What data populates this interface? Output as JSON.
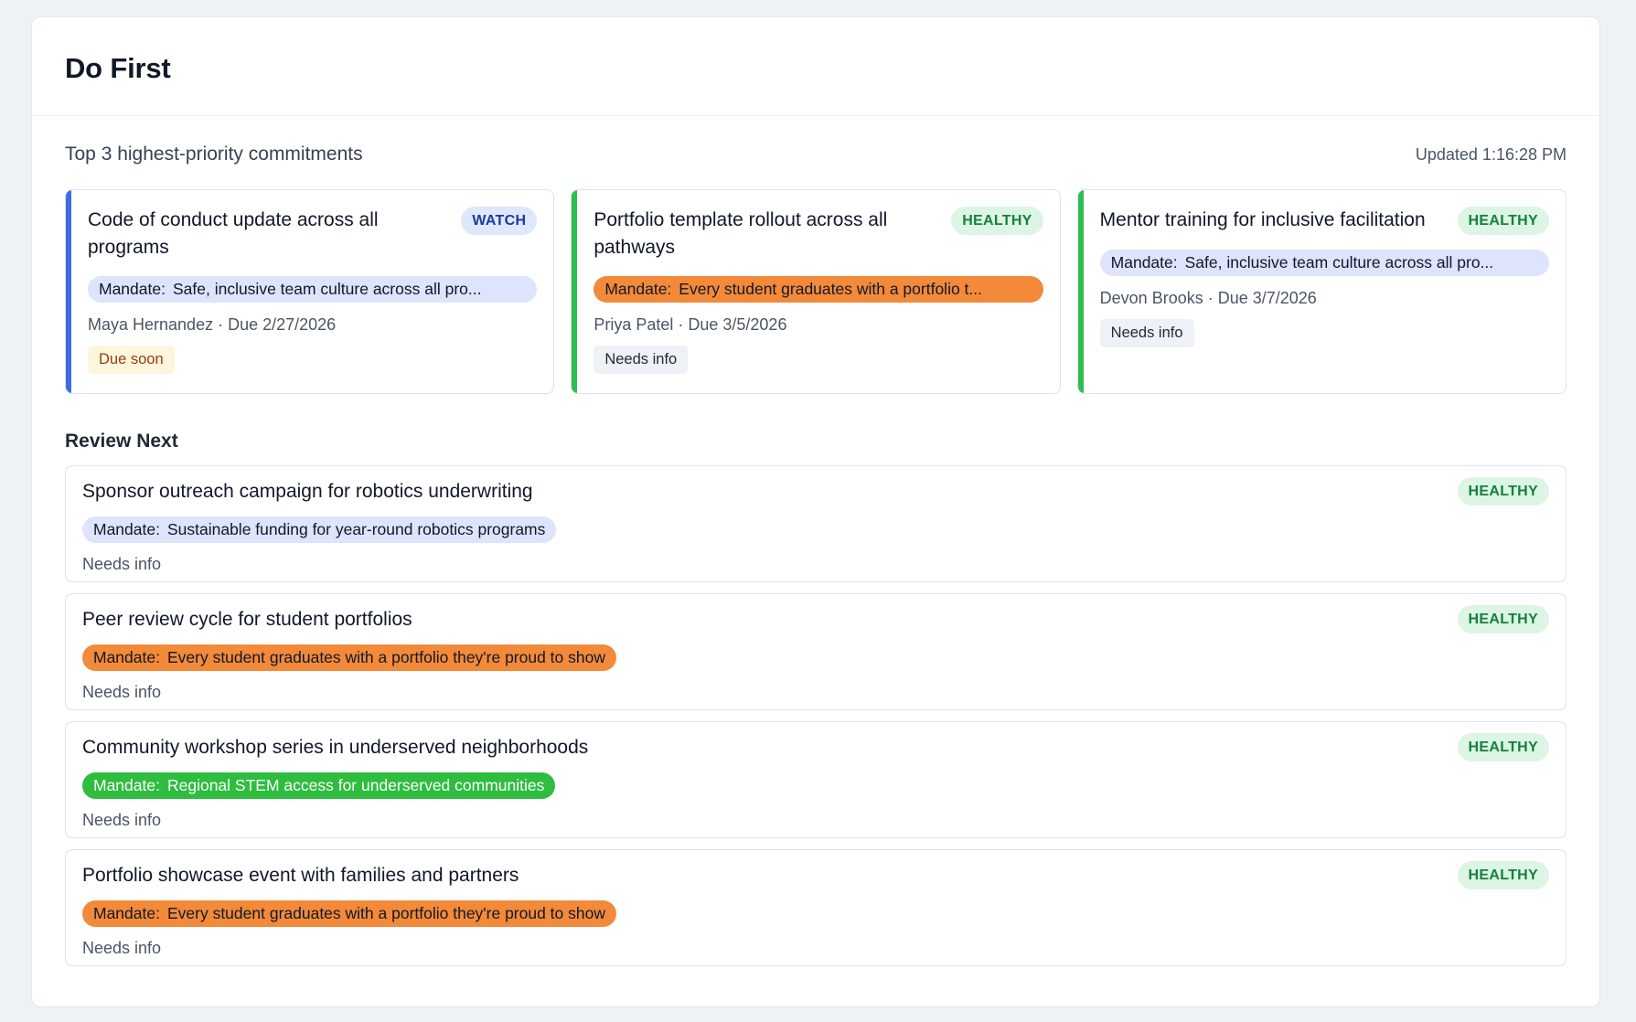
{
  "header": {
    "title": "Do First"
  },
  "subheading": "Top 3 highest-priority commitments",
  "updated": "Updated 1:16:28 PM",
  "mandate_label": "Mandate:",
  "colors": {
    "watch_accent": "#3b6fe0",
    "healthy_accent": "#2ebd50",
    "mandate_blue": "#dde4fb",
    "mandate_orange": "#f28a3a",
    "mandate_green": "#2ebd3f"
  },
  "top_cards": [
    {
      "title": "Code of conduct update across all programs",
      "status": "WATCH",
      "mandate": "Safe, inclusive team culture across all pro...",
      "meta": "Maya Hernandez · Due 2/27/2026",
      "chip": "Due soon"
    },
    {
      "title": "Portfolio template rollout across all pathways",
      "status": "HEALTHY",
      "mandate": "Every student graduates with a portfolio t...",
      "meta": "Priya Patel · Due 3/5/2026",
      "chip": "Needs info"
    },
    {
      "title": "Mentor training for inclusive facilitation",
      "status": "HEALTHY",
      "mandate": "Safe, inclusive team culture across all pro...",
      "meta": "Devon Brooks · Due 3/7/2026",
      "chip": "Needs info"
    }
  ],
  "review_next": {
    "title": "Review Next",
    "items": [
      {
        "title": "Sponsor outreach campaign for robotics underwriting",
        "status": "HEALTHY",
        "mandate": "Sustainable funding for year-round robotics programs",
        "note": "Needs info"
      },
      {
        "title": "Peer review cycle for student portfolios",
        "status": "HEALTHY",
        "mandate": "Every student graduates with a portfolio they're proud to show",
        "note": "Needs info"
      },
      {
        "title": "Community workshop series in underserved neighborhoods",
        "status": "HEALTHY",
        "mandate": "Regional STEM access for underserved communities",
        "note": "Needs info"
      },
      {
        "title": "Portfolio showcase event with families and partners",
        "status": "HEALTHY",
        "mandate": "Every student graduates with a portfolio they're proud to show",
        "note": "Needs info"
      }
    ]
  }
}
